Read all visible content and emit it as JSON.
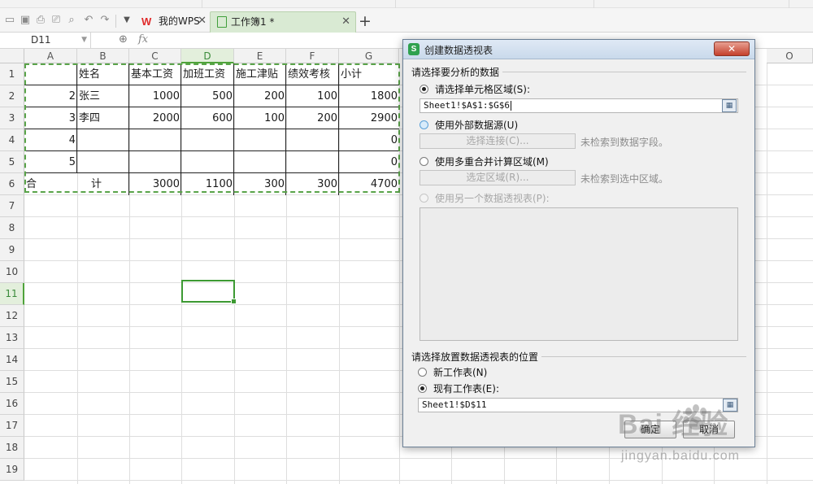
{
  "tabs": [
    {
      "label": "我的WPS",
      "icon": "wps-logo-icon",
      "logo_text": "W"
    },
    {
      "label": "工作簿1 *",
      "icon": "workbook-icon"
    }
  ],
  "formula_bar": {
    "cell_ref": "D11",
    "fx": "fx"
  },
  "columns": [
    "A",
    "B",
    "C",
    "D",
    "E",
    "F",
    "G",
    "O"
  ],
  "rows": [
    "1",
    "2",
    "3",
    "4",
    "5",
    "6",
    "7",
    "8",
    "9",
    "10",
    "11",
    "12",
    "13",
    "14",
    "15",
    "16",
    "17",
    "18",
    "19"
  ],
  "active_column": "D",
  "active_row": "11",
  "table": {
    "header": [
      "",
      "姓名",
      "基本工资",
      "加班工资",
      "施工津贴",
      "绩效考核",
      "小计"
    ],
    "rows": [
      [
        "2",
        "张三",
        "1000",
        "500",
        "200",
        "100",
        "1800"
      ],
      [
        "3",
        "李四",
        "2000",
        "600",
        "100",
        "200",
        "2900"
      ],
      [
        "4",
        "",
        "",
        "",
        "",
        "",
        "0"
      ],
      [
        "5",
        "",
        "",
        "",
        "",
        "",
        "0"
      ]
    ],
    "total": {
      "label_1": "合",
      "label_2": "计",
      "values": [
        "3000",
        "1100",
        "300",
        "300",
        "4700"
      ]
    }
  },
  "dialog": {
    "title": "创建数据透视表",
    "icon_text": "S",
    "close_label": "✕",
    "section1_label": "请选择要分析的数据",
    "opt_range": "请选择单元格区域(S):",
    "range_value": "Sheet1!$A$1:$G$6",
    "opt_external": "使用外部数据源(U)",
    "btn_choose_connection": "选择连接(C)...",
    "hint_no_fields": "未检索到数据字段。",
    "opt_multi": "使用多重合并计算区域(M)",
    "btn_select_range": "选定区域(R)...",
    "hint_no_range": "未检索到选中区域。",
    "opt_other_pivot": "使用另一个数据透视表(P):",
    "section2_label": "请选择放置数据透视表的位置",
    "opt_new_sheet": "新工作表(N)",
    "opt_existing_sheet": "现有工作表(E):",
    "location_value": "Sheet1!$D$11",
    "ok_label": "确定",
    "cancel_label": "取消"
  },
  "watermark": {
    "main": "Bai  经验",
    "sub": "jingyan.baidu.com"
  }
}
